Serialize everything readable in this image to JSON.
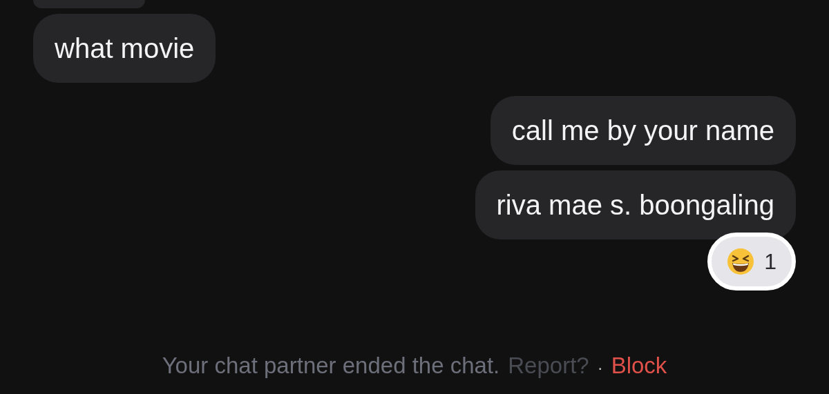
{
  "partial_bubble_above": true,
  "messages": [
    {
      "text": "what movie",
      "kind": "received"
    },
    {
      "text": "call me by your name",
      "kind": "sent"
    },
    {
      "text": "riva mae s. boongaling",
      "kind": "sent",
      "reaction": {
        "count": "1"
      }
    }
  ],
  "footer": {
    "notice": "Your chat partner ended the chat.",
    "report": "Report?",
    "separator": "·",
    "block": "Block"
  }
}
